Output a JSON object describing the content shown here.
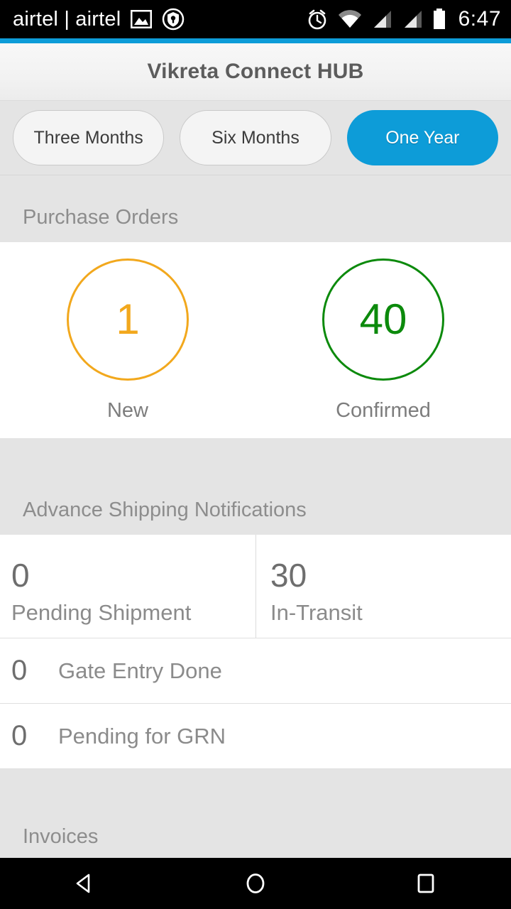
{
  "status_bar": {
    "carrier": "airtel | airtel",
    "time": "6:47",
    "left_icons": [
      "image-icon",
      "shield-badge-icon"
    ],
    "right_icons": [
      "alarm-icon",
      "wifi-icon",
      "signal-icon-1",
      "signal-icon-2",
      "battery-icon"
    ]
  },
  "header": {
    "title": "Vikreta Connect HUB",
    "accent_color": "#0d9cd8"
  },
  "filters": {
    "options": [
      {
        "label": "Three Months",
        "selected": false
      },
      {
        "label": "Six Months",
        "selected": false
      },
      {
        "label": "One Year",
        "selected": true
      }
    ]
  },
  "sections": {
    "purchase_orders": {
      "title": "Purchase Orders",
      "metrics": [
        {
          "value": "1",
          "label": "New",
          "color": "#f2a81d"
        },
        {
          "value": "40",
          "label": "Confirmed",
          "color": "#0c8a0c"
        }
      ]
    },
    "advance_shipping_notifications": {
      "title": "Advance Shipping Notifications",
      "split_metrics": [
        {
          "value": "0",
          "label": "Pending Shipment"
        },
        {
          "value": "30",
          "label": "In-Transit"
        }
      ],
      "inline_metrics": [
        {
          "value": "0",
          "label": "Gate Entry Done"
        },
        {
          "value": "0",
          "label": "Pending for GRN"
        }
      ]
    },
    "invoices": {
      "title": "Invoices"
    }
  },
  "nav_bar": {
    "buttons": [
      "back-button",
      "home-button",
      "recents-button"
    ]
  }
}
